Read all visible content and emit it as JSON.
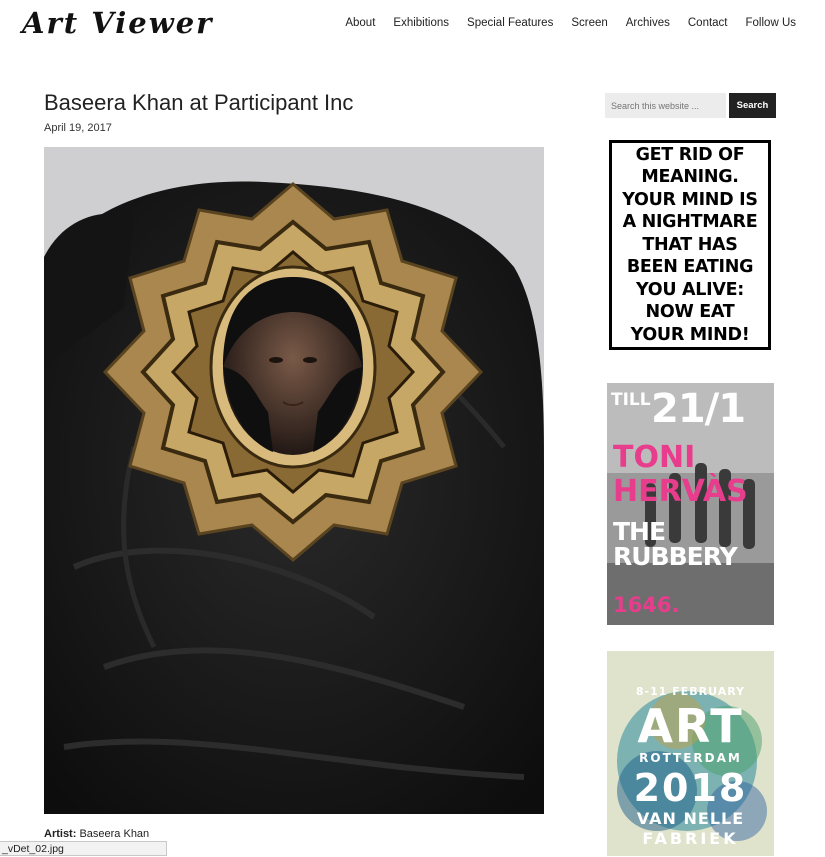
{
  "site": {
    "logo": "Art Viewer"
  },
  "nav": {
    "items": [
      "About",
      "Exhibitions",
      "Special Features",
      "Screen",
      "Archives",
      "Contact",
      "Follow Us"
    ]
  },
  "post": {
    "title": "Baseera Khan at Participant Inc",
    "date": "April 19, 2017",
    "artist_label": "Artist:",
    "artist_value": "Baseera Khan"
  },
  "search": {
    "placeholder": "Search this website ...",
    "button": "Search"
  },
  "ads": {
    "ad1_text": "GET RID OF\nMEANING.\nYOUR MIND IS\nA NIGHTMARE\nTHAT HAS\nBEEN EATING\nYOU ALIVE:\nNOW EAT\nYOUR MIND!",
    "ad2": {
      "till": "TILL",
      "date": "21/1",
      "artist1": "TONI",
      "artist2": "HERVÀS",
      "show": "THE RUBBERY",
      "venue": "1646."
    },
    "ad3": {
      "dates": "8-11 FEBRUARY",
      "art": "ART",
      "city": "ROTTERDAM",
      "year": "2018",
      "venue1": "VAN NELLE",
      "venue2": "FABRIEK"
    }
  },
  "statusbar": {
    "text": "_vDet_02.jpg"
  },
  "colors": {
    "accent_pink": "#e83c8c",
    "button_bg": "#222222"
  }
}
